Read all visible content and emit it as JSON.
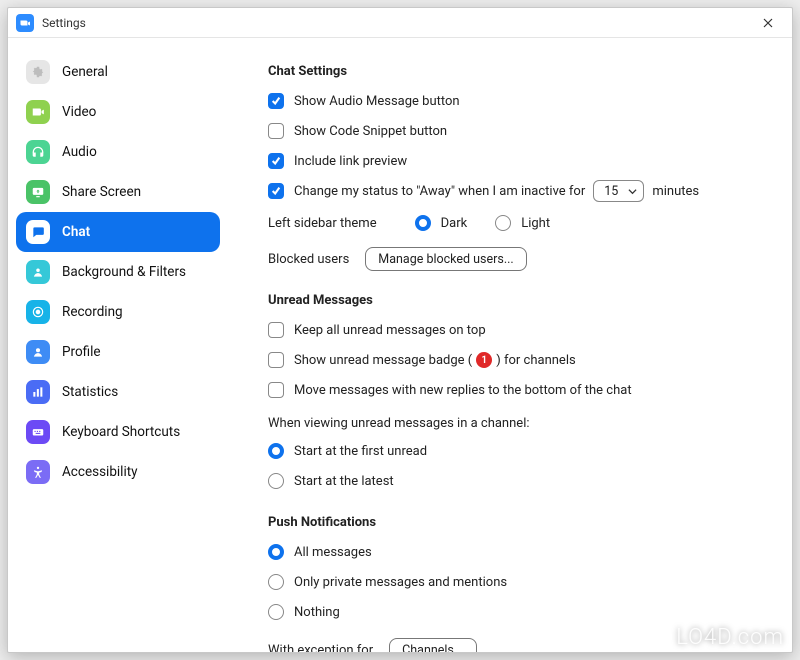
{
  "window": {
    "title": "Settings"
  },
  "sidebar": {
    "items": [
      {
        "id": "general",
        "label": "General",
        "color": "#E6E6E6"
      },
      {
        "id": "video",
        "label": "Video",
        "color": "#8FD14F"
      },
      {
        "id": "audio",
        "label": "Audio",
        "color": "#4CD493"
      },
      {
        "id": "share-screen",
        "label": "Share Screen",
        "color": "#4AC367"
      },
      {
        "id": "chat",
        "label": "Chat",
        "color": "#0E72ED",
        "active": true
      },
      {
        "id": "background",
        "label": "Background & Filters",
        "color": "#35C8D8"
      },
      {
        "id": "recording",
        "label": "Recording",
        "color": "#17B3E8"
      },
      {
        "id": "profile",
        "label": "Profile",
        "color": "#3E8CF5"
      },
      {
        "id": "statistics",
        "label": "Statistics",
        "color": "#4A6CF5"
      },
      {
        "id": "keyboard",
        "label": "Keyboard Shortcuts",
        "color": "#6C4AF5"
      },
      {
        "id": "accessibility",
        "label": "Accessibility",
        "color": "#7B6CF5"
      }
    ]
  },
  "content": {
    "chatSettings": {
      "title": "Chat Settings",
      "audio": {
        "label": "Show Audio Message button",
        "checked": true
      },
      "code": {
        "label": "Show Code Snippet button",
        "checked": false
      },
      "link": {
        "label": "Include link preview",
        "checked": true
      },
      "away": {
        "prefix": "Change my status to \"Away\" when I am inactive for",
        "value": "15",
        "suffix": "minutes",
        "checked": true
      },
      "theme": {
        "label": "Left sidebar theme",
        "dark": "Dark",
        "light": "Light",
        "value": "dark"
      },
      "blocked": {
        "label": "Blocked users",
        "button": "Manage blocked users..."
      }
    },
    "unread": {
      "title": "Unread Messages",
      "keepTop": {
        "label": "Keep all unread messages on top",
        "checked": false
      },
      "badge": {
        "prefix": "Show unread message badge (",
        "count": "1",
        "suffix": ") for channels",
        "checked": false
      },
      "moveReplies": {
        "label": "Move messages with new replies to the bottom of the chat",
        "checked": false
      },
      "whenViewing": "When viewing unread messages in a channel:",
      "startFirst": {
        "label": "Start at the first unread",
        "selected": true
      },
      "startLatest": {
        "label": "Start at the latest",
        "selected": false
      }
    },
    "push": {
      "title": "Push Notifications",
      "all": {
        "label": "All messages",
        "selected": true
      },
      "private": {
        "label": "Only private messages and mentions",
        "selected": false
      },
      "nothing": {
        "label": "Nothing",
        "selected": false
      },
      "exception": {
        "label": "With exception for",
        "button": "Channels..."
      }
    }
  },
  "watermark": "LO4D.com"
}
